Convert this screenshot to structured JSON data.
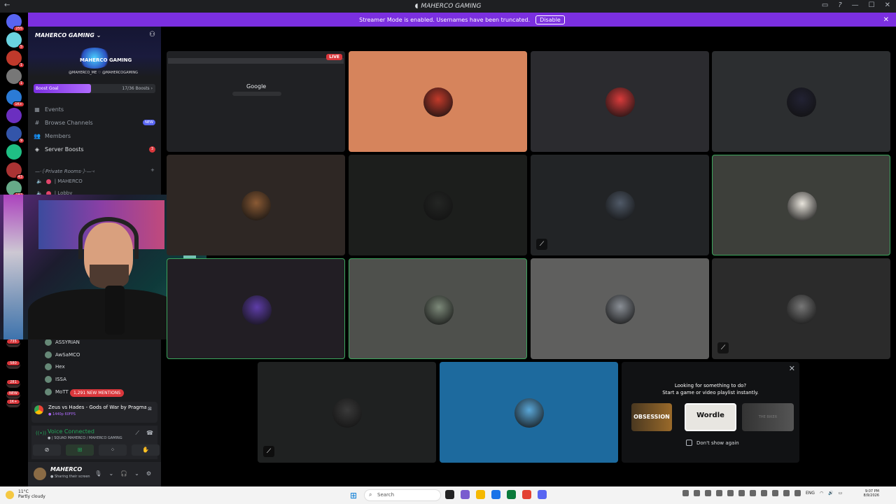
{
  "window": {
    "title": "MAHERCO GAMING",
    "back_glyph": "←",
    "controls": [
      "▭",
      "?",
      "—",
      "☐",
      "✕"
    ]
  },
  "banner": {
    "text": "Streamer Mode is enabled. Usernames have been truncated.",
    "button": "Disable",
    "close": "✕"
  },
  "rail": {
    "servers": [
      {
        "badge": "255",
        "color": "#5865f2"
      },
      {
        "badge": "5",
        "color": "#6ad3e0"
      },
      {
        "badge": "1",
        "color": "#c0392b"
      },
      {
        "badge": "1",
        "color": "#777777"
      },
      {
        "badge": "1K+",
        "color": "#2b7bd6"
      },
      {
        "badge": "",
        "color": "#6b2fc0"
      },
      {
        "badge": "9",
        "color": "#3355aa"
      },
      {
        "badge": "",
        "color": "#1fbf84"
      },
      {
        "badge": "43",
        "color": "#a33"
      },
      {
        "badge": "187",
        "color": "#6a8"
      }
    ],
    "lower_badges": [
      "735",
      "580",
      "281",
      "NEW",
      "1K+"
    ]
  },
  "sidebar": {
    "server_name": "MAHERCO GAMING",
    "server_logo_text": "MAHERCO GAMING",
    "server_handles": "@MAHERCO_ME ♡ @MAHERCOGAMING",
    "boost": {
      "label": "Boost Goal",
      "count": "17/36 Boosts ›",
      "progress": 0.47
    },
    "nav": [
      {
        "icon": "▦",
        "label": "Events"
      },
      {
        "icon": "#",
        "label": "Browse Channels",
        "tag": "NEW"
      },
      {
        "icon": "👥",
        "label": "Members"
      },
      {
        "icon": "◈",
        "label": "Server Boosts",
        "count": "3"
      }
    ],
    "category": "—·〔·Private Rooms·〕·—·‹",
    "category_plus": "+",
    "voice_channels": [
      "| MAHERCO",
      "| Lobby"
    ],
    "members": [
      "ASSYRIAN",
      "AwSaMCO",
      "Hex",
      "ISSA",
      "MoTT"
    ],
    "mentions_pill": "1,291 NEW MENTIONS"
  },
  "activity": {
    "title": "Zeus vs Hades - Gods of War by Pragmatic...",
    "subtitle": "● 1440p 60FPS",
    "close": "⊠"
  },
  "voice": {
    "status": "Voice Connected",
    "room": "● | SQUAD MAHERCO / MAHERCO GAMING",
    "signal": "((•))",
    "right_icons": [
      "⟋",
      "☎"
    ],
    "buttons": [
      "⊘",
      "⊞",
      "⁘",
      "✋"
    ]
  },
  "user": {
    "name": "MAHERCO",
    "status": "● Sharing their screen",
    "controls": [
      "🎙",
      "⌄",
      "🎧",
      "⌄",
      "⚙"
    ]
  },
  "grid": {
    "live_label": "LIVE",
    "google_label": "Google",
    "tiles": [
      {
        "bg": "#202124",
        "type": "screen",
        "speaking": false,
        "muted": false
      },
      {
        "bg": "#d6845c",
        "avatar": "#c23a2a",
        "speaking": false,
        "muted": false
      },
      {
        "bg": "#2b2b2f",
        "avatar": "#d93b3b",
        "speaking": false,
        "muted": false
      },
      {
        "bg": "#2c2e30",
        "avatar": "#223",
        "speaking": false,
        "muted": false
      },
      {
        "bg": "#2e2724",
        "avatar": "#8a5a34",
        "speaking": false,
        "muted": false
      },
      {
        "bg": "#1c1e1c",
        "avatar": "#242624",
        "speaking": false,
        "muted": false
      },
      {
        "bg": "#222426",
        "avatar": "#505a68",
        "speaking": false,
        "muted": true
      },
      {
        "bg": "#3d3f3a",
        "avatar": "#e8e4dc",
        "speaking": true,
        "muted": false
      },
      {
        "bg": "#221e24",
        "avatar": "#5e3da8",
        "speaking": true,
        "muted": false
      },
      {
        "bg": "#4e504c",
        "avatar": "#7d8a7a",
        "speaking": true,
        "muted": false
      },
      {
        "bg": "#5f5f5e",
        "avatar": "#8a8f96",
        "speaking": false,
        "muted": false
      },
      {
        "bg": "#2b2b2b",
        "avatar": "#777777",
        "speaking": false,
        "muted": true
      },
      {
        "bg": "#1f2121",
        "avatar": "#3a3a3a",
        "speaking": false,
        "muted": true
      },
      {
        "bg": "#1d6a9e",
        "avatar": "#5aa7d8",
        "speaking": false,
        "muted": false
      }
    ],
    "mute_glyph": "⟋"
  },
  "popup": {
    "line1": "Looking for something to do?",
    "line2": "Start a game or video playlist instantly.",
    "cards": [
      "OBSESSION",
      "Wordle",
      "THE BIKER"
    ],
    "dont_show": "Don't show again",
    "close": "✕"
  },
  "taskbar": {
    "weather_temp": "11°C",
    "weather_desc": "Partly cloudy",
    "search_placeholder": "Search",
    "lang": "ENG",
    "time": "9:07 PM",
    "date": "8/9/2026",
    "app_colors": [
      "#222222",
      "#7a5ccf",
      "#f5b800",
      "#1a73e8",
      "#0a7a3a",
      "#e34133",
      "#5865f2"
    ]
  }
}
